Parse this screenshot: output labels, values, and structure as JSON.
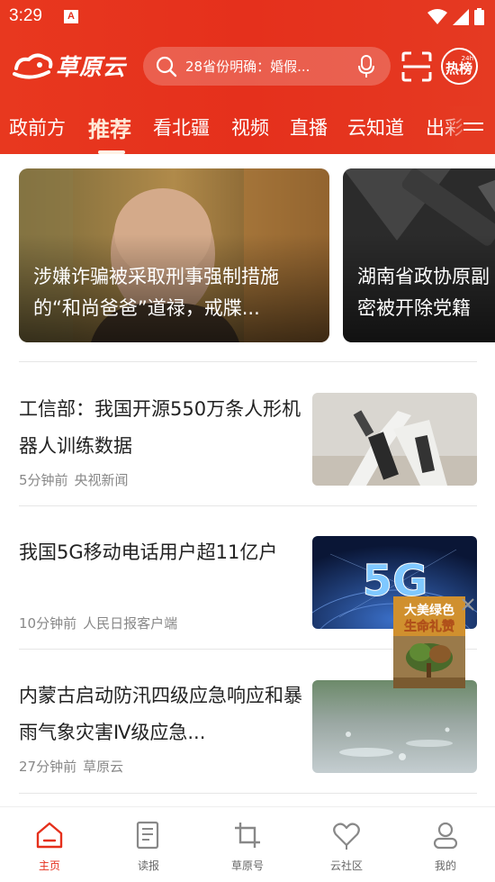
{
  "status_bar": {
    "time": "3:29",
    "notification_badge": "A"
  },
  "header": {
    "logo_text": "草原云",
    "search": {
      "text": "28省份明确：婚假..."
    },
    "hot_badge": {
      "label": "热榜",
      "superscript": "24h"
    }
  },
  "tabs": [
    {
      "label": "政前方"
    },
    {
      "label": "推荐",
      "active": true
    },
    {
      "label": "看北疆"
    },
    {
      "label": "视频"
    },
    {
      "label": "直播"
    },
    {
      "label": "云知道"
    },
    {
      "label": "出彩"
    }
  ],
  "carousel": [
    {
      "title": "涉嫌诈骗被采取刑事强制措施的“和尚爸爸”道禄，戒牒..."
    },
    {
      "title_line1": "湖南省政协原副",
      "title_line2": "密被开除党籍"
    }
  ],
  "news": [
    {
      "title": "工信部：我国开源550万条人形机器人训练数据",
      "time": "5分钟前",
      "source": "央视新闻"
    },
    {
      "title": "我国5G移动电话用户超11亿户",
      "time": "10分钟前",
      "source": "人民日报客户端",
      "thumb_text": "5G"
    },
    {
      "title": "内蒙古启动防汛四级应急响应和暴雨气象灾害Ⅳ级应急...",
      "time": "27分钟前",
      "source": "草原云"
    }
  ],
  "float_ad": {
    "line1": "大美绿色",
    "line2": "生命礼赞"
  },
  "bottom_nav": [
    {
      "label": "主页",
      "active": true
    },
    {
      "label": "读报"
    },
    {
      "label": "草原号"
    },
    {
      "label": "云社区"
    },
    {
      "label": "我的"
    }
  ],
  "colors": {
    "brand_red": "#e5301c",
    "text_dark": "#222222",
    "text_meta": "#888888"
  }
}
